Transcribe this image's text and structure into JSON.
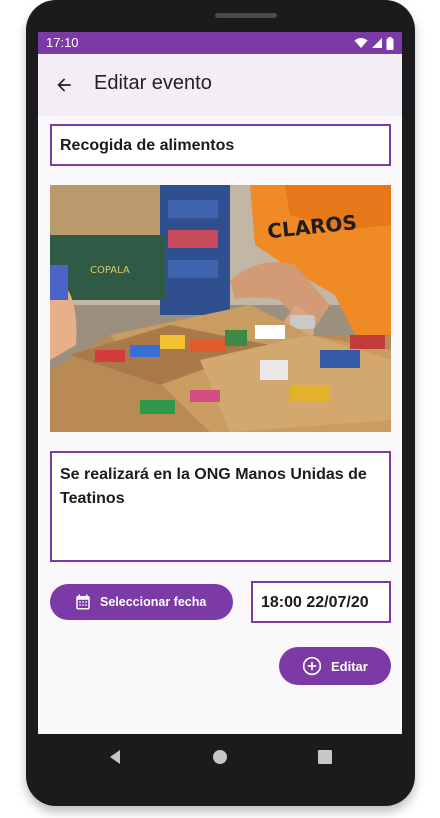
{
  "status_bar": {
    "time": "17:10"
  },
  "app_bar": {
    "title": "Editar evento"
  },
  "event": {
    "title": "Recogida de alimentos",
    "description": "Se realizará en la ONG Manos Unidas de Teatinos",
    "datetime": "18:00 22/07/20"
  },
  "buttons": {
    "select_date": "Seleccionar fecha",
    "edit": "Editar"
  },
  "image": {
    "shirt_text": "CLAROS"
  },
  "colors": {
    "accent": "#7b3aa6",
    "app_bar_bg": "#f3edf5",
    "screen_bg": "#fbf8fb"
  },
  "icons": {
    "back": "arrow-back-icon",
    "calendar": "calendar-icon",
    "add": "add-circle-icon",
    "wifi": "wifi-icon",
    "signal": "signal-icon",
    "battery": "battery-icon",
    "nav_back": "nav-back-icon",
    "nav_home": "nav-home-icon",
    "nav_recents": "nav-recents-icon"
  }
}
